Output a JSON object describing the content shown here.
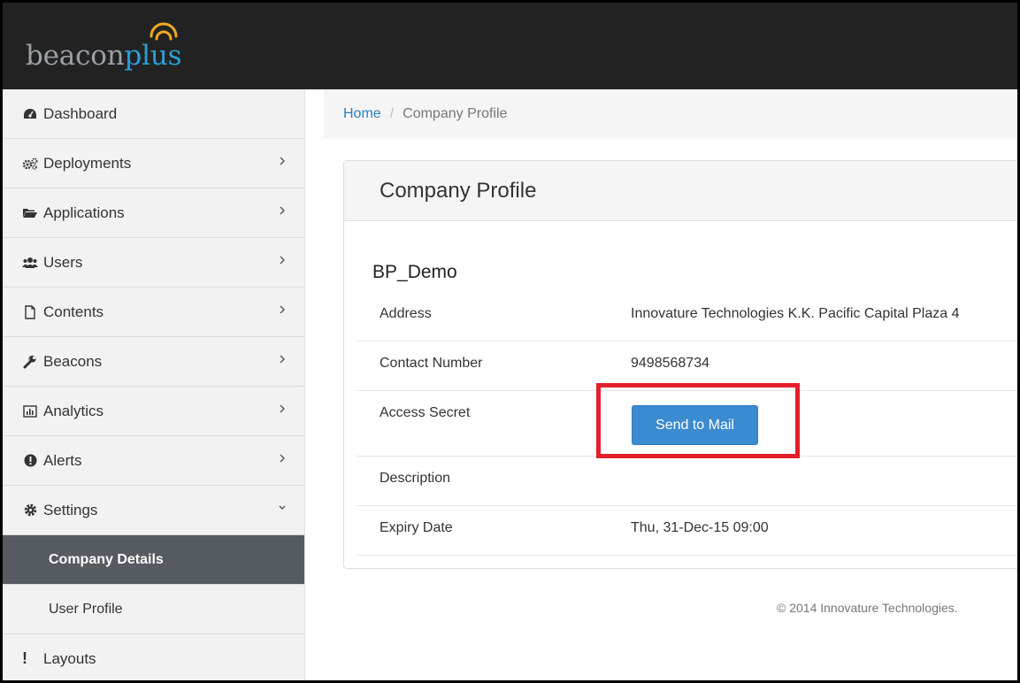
{
  "brand": {
    "part1": "beacon",
    "part2": "plus"
  },
  "sidebar": {
    "items": [
      {
        "label": "Dashboard",
        "icon": "dashboard-icon",
        "chevron": ""
      },
      {
        "label": "Deployments",
        "icon": "gears-icon",
        "chevron": "right"
      },
      {
        "label": "Applications",
        "icon": "folder-open-icon",
        "chevron": "right"
      },
      {
        "label": "Users",
        "icon": "users-icon",
        "chevron": "right"
      },
      {
        "label": "Contents",
        "icon": "file-icon",
        "chevron": "right"
      },
      {
        "label": "Beacons",
        "icon": "wrench-icon",
        "chevron": "right"
      },
      {
        "label": "Analytics",
        "icon": "bar-chart-icon",
        "chevron": "right"
      },
      {
        "label": "Alerts",
        "icon": "exclamation-circle-icon",
        "chevron": "right"
      },
      {
        "label": "Settings",
        "icon": "cog-icon",
        "chevron": "down"
      }
    ],
    "subitems": [
      {
        "label": "Company Details",
        "active": true
      },
      {
        "label": "User Profile",
        "active": false
      }
    ],
    "last": {
      "label": "Layouts",
      "icon_glyph": "!"
    }
  },
  "breadcrumb": {
    "home": "Home",
    "separator": "/",
    "current": "Company Profile"
  },
  "panel": {
    "title": "Company Profile",
    "company_name": "BP_Demo",
    "rows": [
      {
        "label": "Address",
        "value": "Innovature Technologies K.K. Pacific Capital Plaza 4"
      },
      {
        "label": "Contact Number",
        "value": "9498568734"
      },
      {
        "label": "Access Secret",
        "button": "Send to Mail"
      },
      {
        "label": "Description",
        "value": ""
      },
      {
        "label": "Expiry Date",
        "value": "Thu, 31-Dec-15 09:00"
      }
    ]
  },
  "footer": {
    "text": "© 2014 Innovature Technologies."
  },
  "colors": {
    "header_bg": "#222222",
    "accent": "#3b8bd0",
    "active_nav": "#555b60",
    "highlight": "#e3202b",
    "link": "#2a7fc1"
  }
}
